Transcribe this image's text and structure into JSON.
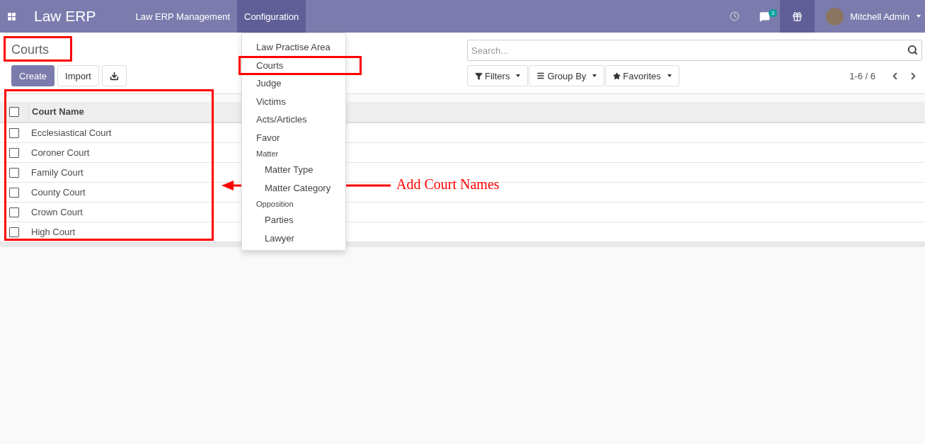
{
  "navbar": {
    "app_title": "Law ERP",
    "menus": [
      {
        "label": "Law ERP Management",
        "selected": false
      },
      {
        "label": "Configuration",
        "selected": true
      }
    ],
    "messages_count": "3",
    "user": "Mitchell Admin"
  },
  "dropdown": [
    {
      "kind": "item",
      "label": "Law Practise Area"
    },
    {
      "kind": "item",
      "label": "Courts"
    },
    {
      "kind": "item",
      "label": "Judge"
    },
    {
      "kind": "item",
      "label": "Victims"
    },
    {
      "kind": "item",
      "label": "Acts/Articles"
    },
    {
      "kind": "item",
      "label": "Favor"
    },
    {
      "kind": "header",
      "label": "Matter"
    },
    {
      "kind": "subitem",
      "label": "Matter Type"
    },
    {
      "kind": "subitem",
      "label": "Matter Category"
    },
    {
      "kind": "header",
      "label": "Opposition"
    },
    {
      "kind": "subitem",
      "label": "Parties"
    },
    {
      "kind": "subitem",
      "label": "Lawyer"
    }
  ],
  "page_title": "Courts",
  "buttons": {
    "create": "Create",
    "import": "Import"
  },
  "search": {
    "placeholder": "Search..."
  },
  "filters": [
    "Filters",
    "Group By",
    "Favorites"
  ],
  "pager": "1-6 / 6",
  "table": {
    "columns": [
      "Court Name"
    ],
    "header_checked": false,
    "rows": [
      {
        "name": "Ecclesiastical Court",
        "checked": false
      },
      {
        "name": "Coroner Court",
        "checked": false
      },
      {
        "name": "Family Court",
        "checked": false
      },
      {
        "name": "County Court",
        "checked": false
      },
      {
        "name": "Crown Court",
        "checked": false
      },
      {
        "name": "High Court",
        "checked": false
      }
    ]
  },
  "annotation": {
    "label": "Add Court Names"
  }
}
